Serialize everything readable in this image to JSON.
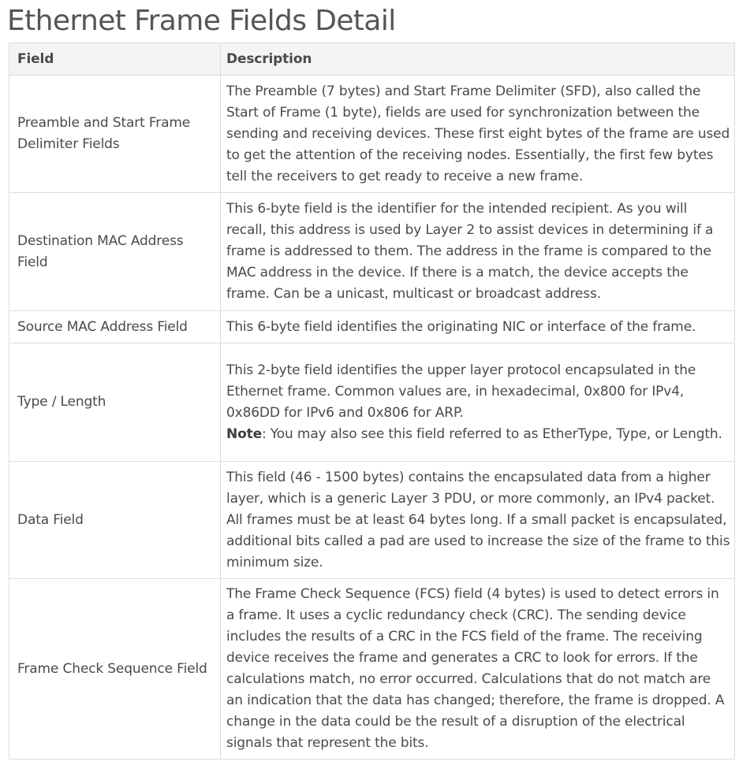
{
  "page": {
    "title": "Ethernet Frame Fields Detail"
  },
  "table": {
    "headers": {
      "field": "Field",
      "description": "Description"
    },
    "rows": [
      {
        "field": "Preamble and Start Frame Delimiter Fields",
        "description": "The Preamble (7 bytes) and Start Frame Delimiter (SFD), also called the Start of Frame (1 byte), fields are used for synchronization between the sending and receiving devices. These first eight bytes of the frame are used to get the attention of the receiving nodes. Essentially, the first few bytes tell the receivers to get ready to receive a new frame."
      },
      {
        "field": "Destination MAC Address Field",
        "description": "This 6-byte field is the identifier for the intended recipient. As you will recall, this address is used by Layer 2 to assist devices in determining if a frame is addressed to them. The address in the frame is compared to the MAC address in the device. If there is a match, the device accepts the frame. Can be a unicast, multicast or broadcast address."
      },
      {
        "field": "Source MAC Address Field",
        "description": "This 6-byte field identifies the originating NIC or interface of the frame."
      },
      {
        "field": "Type / Length",
        "description": "This 2-byte field identifies the upper layer protocol encapsulated in the Ethernet frame. Common values are, in hexadecimal, 0x800 for IPv4, 0x86DD for IPv6 and 0x806 for ARP.",
        "note_label": "Note",
        "note_text": ": You may also see this field referred to as EtherType, Type, or Length."
      },
      {
        "field": "Data Field",
        "description": "This field (46 - 1500 bytes) contains the encapsulated data from a higher layer, which is a generic Layer 3 PDU, or more commonly, an IPv4 packet. All frames must be at least 64 bytes long. If a small packet is encapsulated, additional bits called a pad are used to increase the size of the frame to this minimum size."
      },
      {
        "field": "Frame Check Sequence Field",
        "description": "The Frame Check Sequence (FCS) field (4 bytes) is used to detect errors in a frame. It uses a cyclic redundancy check (CRC). The sending device includes the results of a CRC in the FCS field of the frame. The receiving device receives the frame and generates a CRC to look for errors. If the calculations match, no error occurred. Calculations that do not match are an indication that the data has changed; therefore, the frame is dropped. A change in the data could be the result of a disruption of the electrical signals that represent the bits."
      }
    ]
  }
}
